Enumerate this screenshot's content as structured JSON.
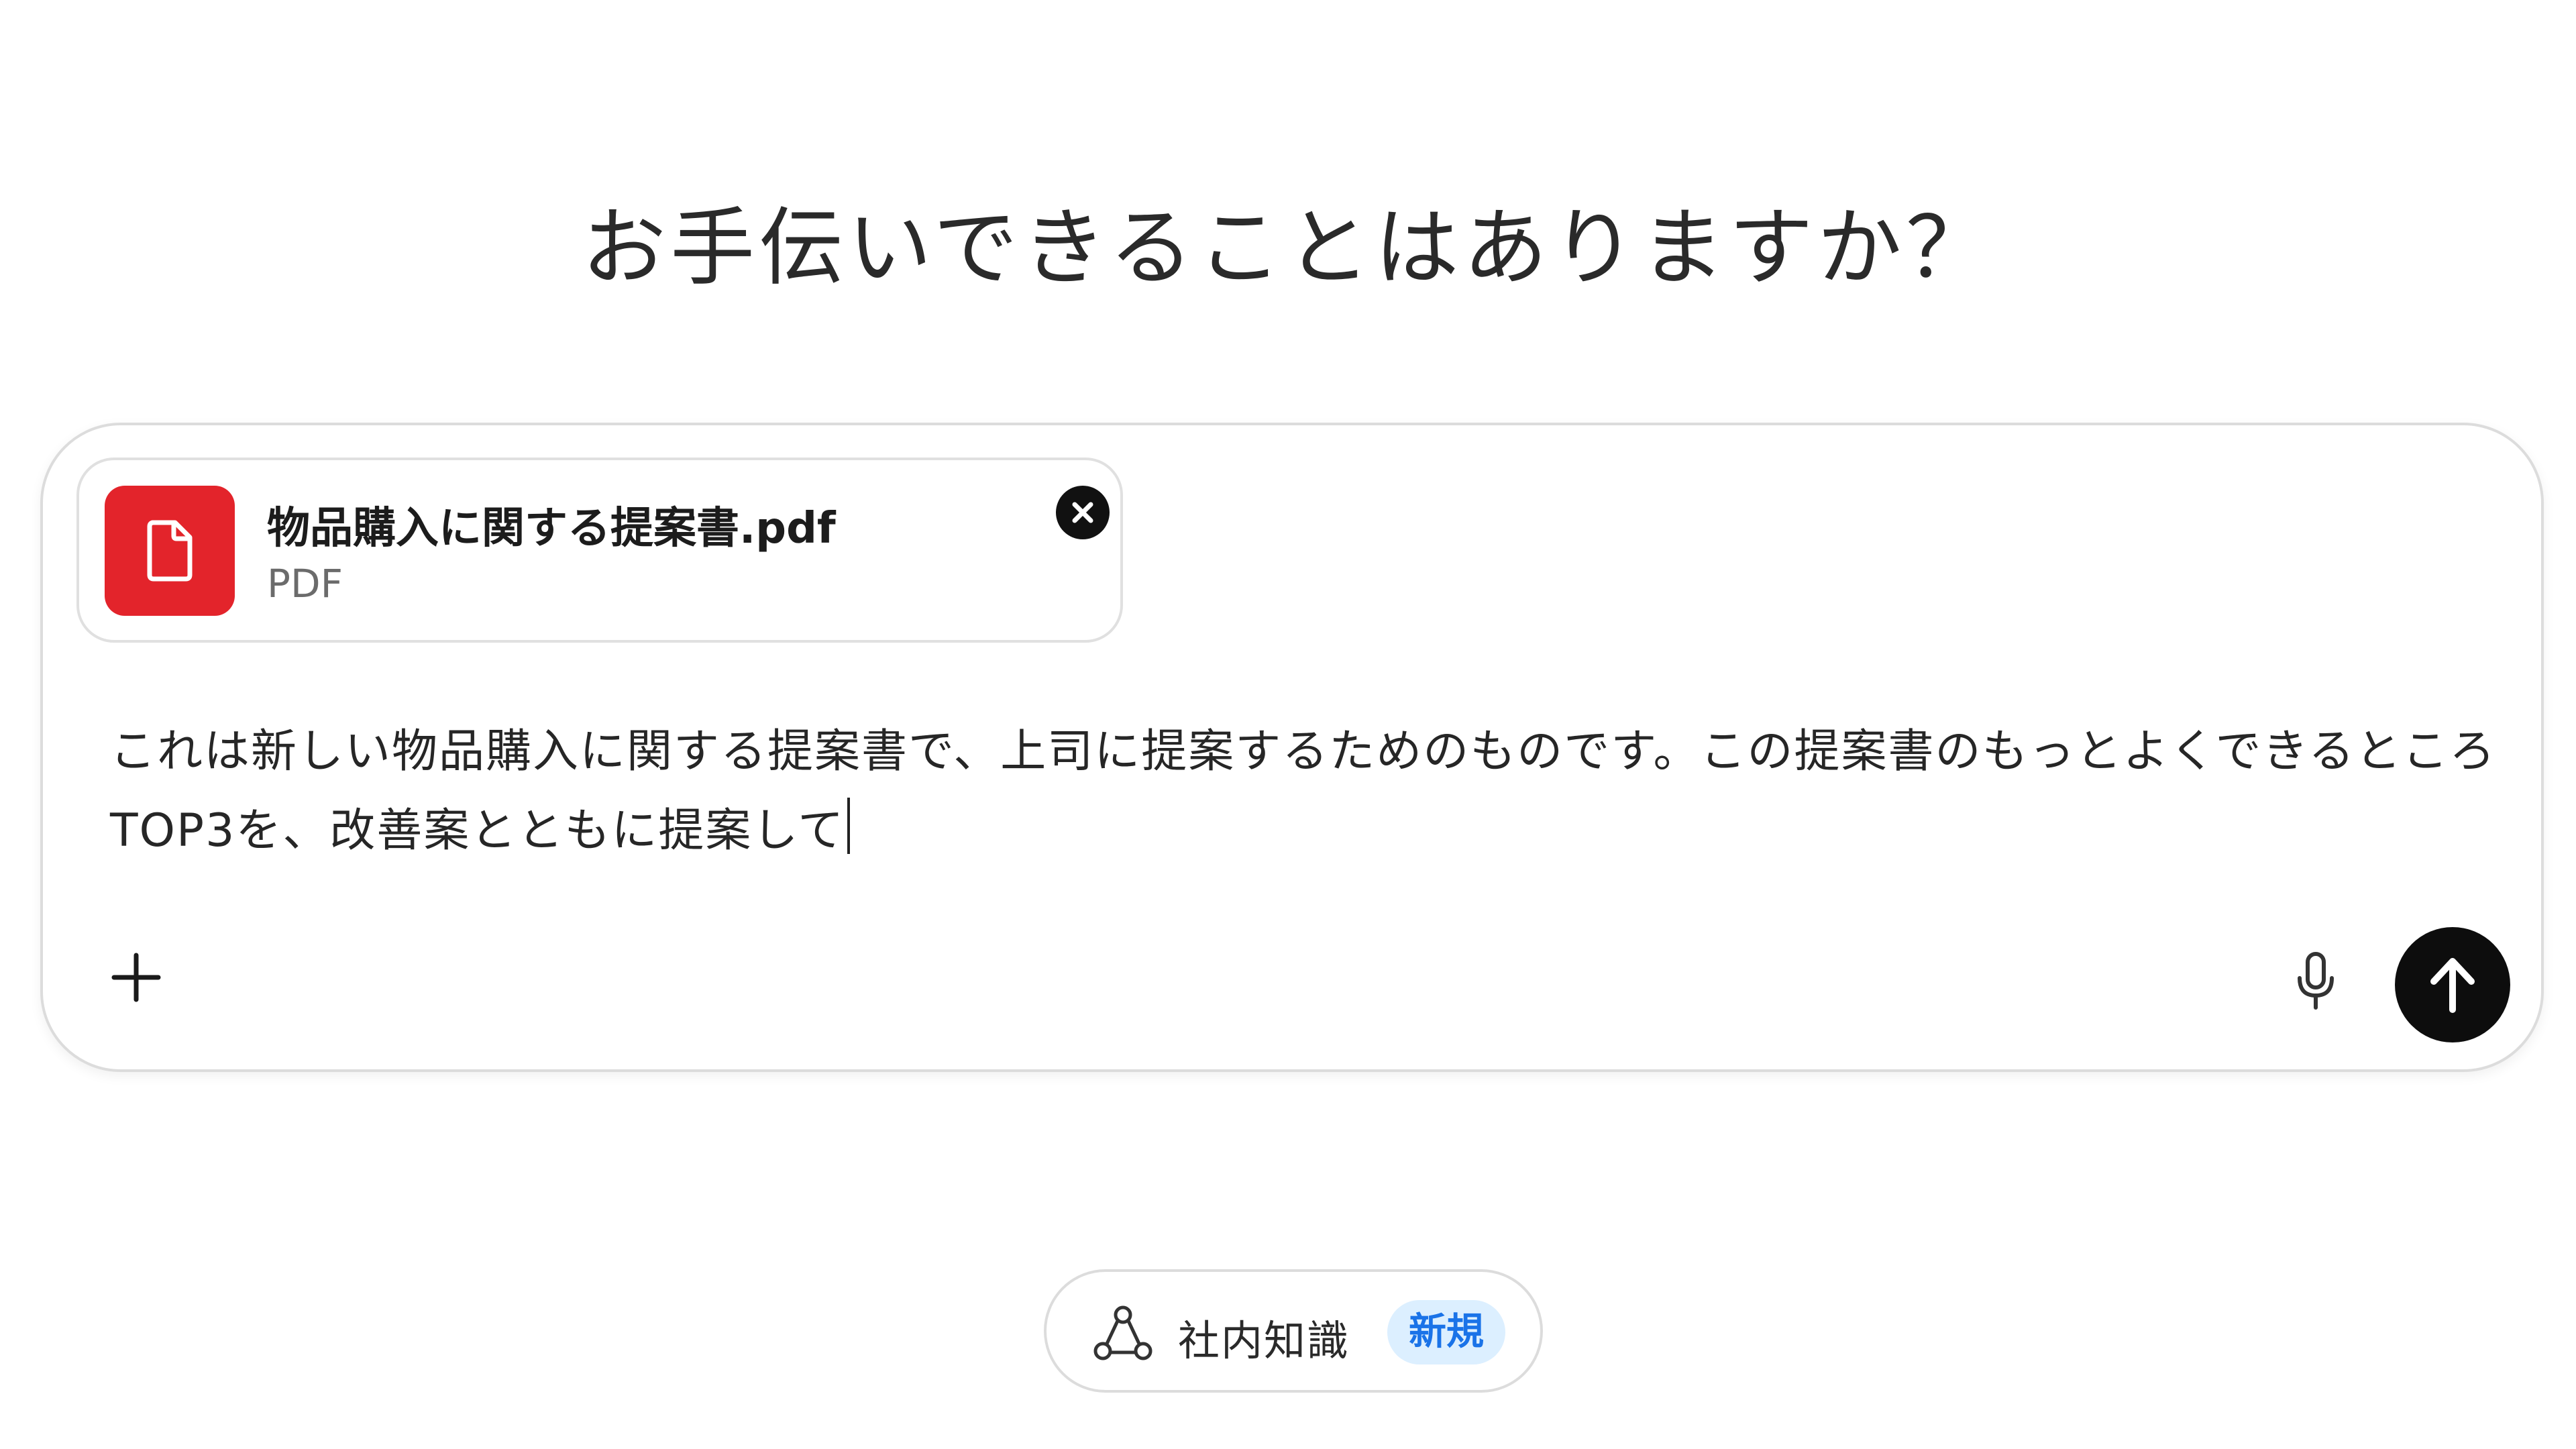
{
  "headline": "お手伝いできることはありますか？",
  "attachment": {
    "file_name": "物品購入に関する提案書.pdf",
    "file_type": "PDF",
    "icon": "document-icon",
    "remove_icon": "close-circle-icon"
  },
  "prompt": {
    "text": "これは新しい物品購入に関する提案書で、上司に提案するためのものです。この提案書のもっとよくできるところTOP3を、改善案とともに提案して"
  },
  "toolbar": {
    "add_icon": "plus-icon",
    "mic_icon": "microphone-icon",
    "send_icon": "arrow-up-icon"
  },
  "knowledge": {
    "label": "社内知識",
    "badge": "新規",
    "icon": "network-icon"
  },
  "colors": {
    "pdf_red": "#e3242b",
    "badge_bg": "#dcefff",
    "badge_text": "#1a73e8",
    "send_bg": "#0d0d0d"
  }
}
